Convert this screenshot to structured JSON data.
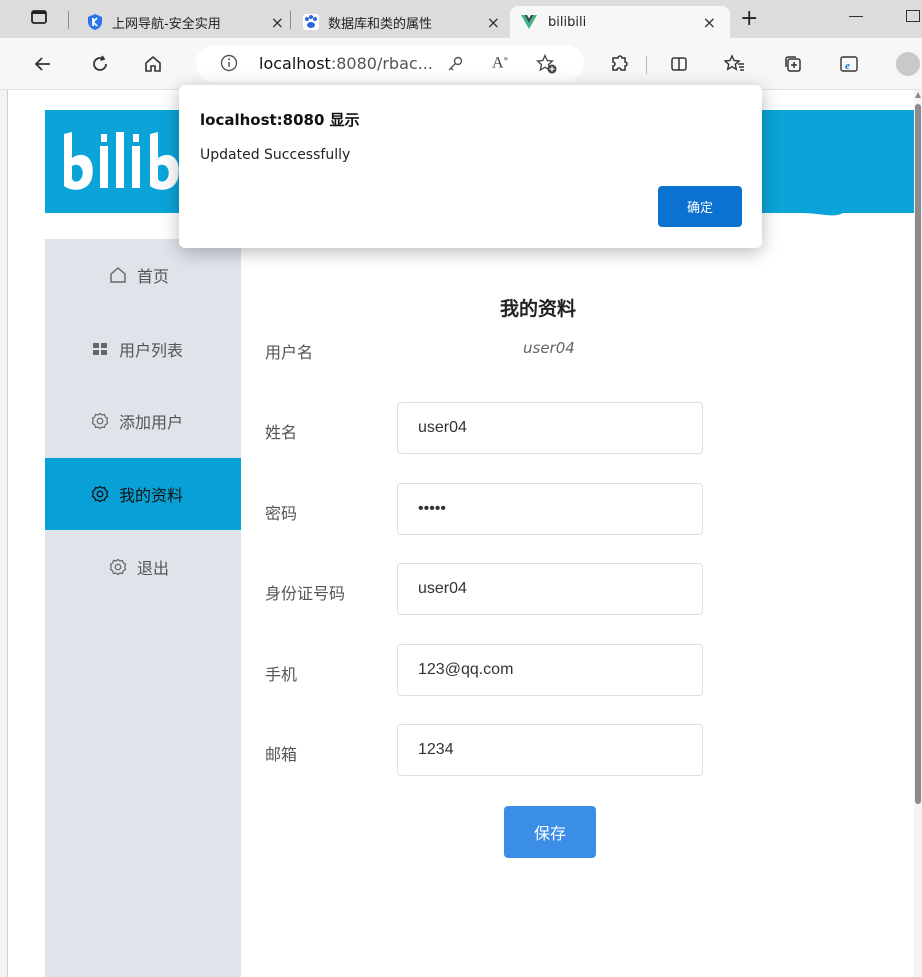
{
  "browser": {
    "tabs": [
      {
        "label": "上网导航-安全实用",
        "favicon": "shield-k-icon"
      },
      {
        "label": "数据库和类的属性",
        "favicon": "baidu-paw-icon"
      },
      {
        "label": "bilibili",
        "favicon": "vue-logo-icon"
      }
    ],
    "new_tab": "+",
    "close_glyph": "×",
    "address": {
      "host": "localhost",
      "rest": ":8080/rbac..."
    }
  },
  "sidebar": {
    "items": [
      {
        "label": "首页",
        "icon": "home-icon"
      },
      {
        "label": "用户列表",
        "icon": "grid-icon"
      },
      {
        "label": "添加用户",
        "icon": "gear-icon"
      },
      {
        "label": "我的资料",
        "icon": "gear-icon",
        "active": true
      },
      {
        "label": "退出",
        "icon": "gear-icon"
      }
    ]
  },
  "form": {
    "title": "我的资料",
    "username_label": "用户名",
    "username_value": "user04",
    "fields": [
      {
        "label": "姓名",
        "value": "user04",
        "type": "text"
      },
      {
        "label": "密码",
        "value": "user0",
        "type": "password"
      },
      {
        "label": "身份证号码",
        "value": "user04",
        "type": "text"
      },
      {
        "label": "手机",
        "value": "123@qq.com",
        "type": "text"
      },
      {
        "label": "邮箱",
        "value": "1234",
        "type": "text"
      }
    ],
    "save_label": "保存"
  },
  "dialog": {
    "title": "localhost:8080 显示",
    "message": "Updated Successfully",
    "ok_label": "确定"
  },
  "colors": {
    "brand": "#0aa4d8",
    "sidebar_bg": "#dfe3ea",
    "sidebar_active": "#08a1d6",
    "save_button": "#3a8ee6",
    "dialog_ok": "#0b72d1"
  }
}
